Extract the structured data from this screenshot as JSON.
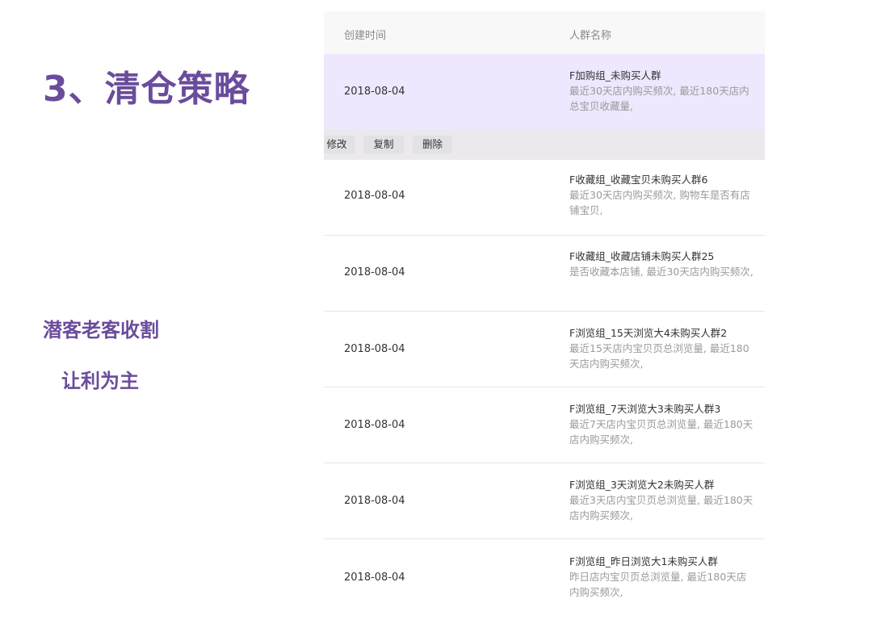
{
  "slide": {
    "title": "3、清仓策略",
    "subtitle_1": "潜客老客收割",
    "subtitle_2": "让利为主"
  },
  "table": {
    "headers": {
      "created_time": "创建时间",
      "group_name": "人群名称"
    },
    "actions": {
      "edit": "修改",
      "copy": "复制",
      "delete": "删除"
    },
    "rows": [
      {
        "date": "2018-08-04",
        "name": "F加购组_未购买人群",
        "desc": "最近30天店内购买频次, 最近180天店内总宝贝收藏量,"
      },
      {
        "date": "2018-08-04",
        "name": "F收藏组_收藏宝贝未购买人群6",
        "desc": "最近30天店内购买频次, 购物车是否有店铺宝贝,"
      },
      {
        "date": "2018-08-04",
        "name": "F收藏组_收藏店铺未购买人群25",
        "desc": "是否收藏本店铺, 最近30天店内购买频次,"
      },
      {
        "date": "2018-08-04",
        "name": "F浏览组_15天浏览大4未购买人群2",
        "desc": "最近15天店内宝贝页总浏览量, 最近180天店内购买频次,"
      },
      {
        "date": "2018-08-04",
        "name": "F浏览组_7天浏览大3未购买人群3",
        "desc": "最近7天店内宝贝页总浏览量, 最近180天店内购买频次,"
      },
      {
        "date": "2018-08-04",
        "name": "F浏览组_3天浏览大2未购买人群",
        "desc": "最近3天店内宝贝页总浏览量, 最近180天店内购买频次,"
      },
      {
        "date": "2018-08-04",
        "name": "F浏览组_昨日浏览大1未购买人群",
        "desc": "昨日店内宝贝页总浏览量, 最近180天店内购买频次,"
      }
    ]
  },
  "colors": {
    "title": "#6a4c9c",
    "highlight_row": "#eee7fd",
    "header_bg": "#f8f8f8"
  }
}
